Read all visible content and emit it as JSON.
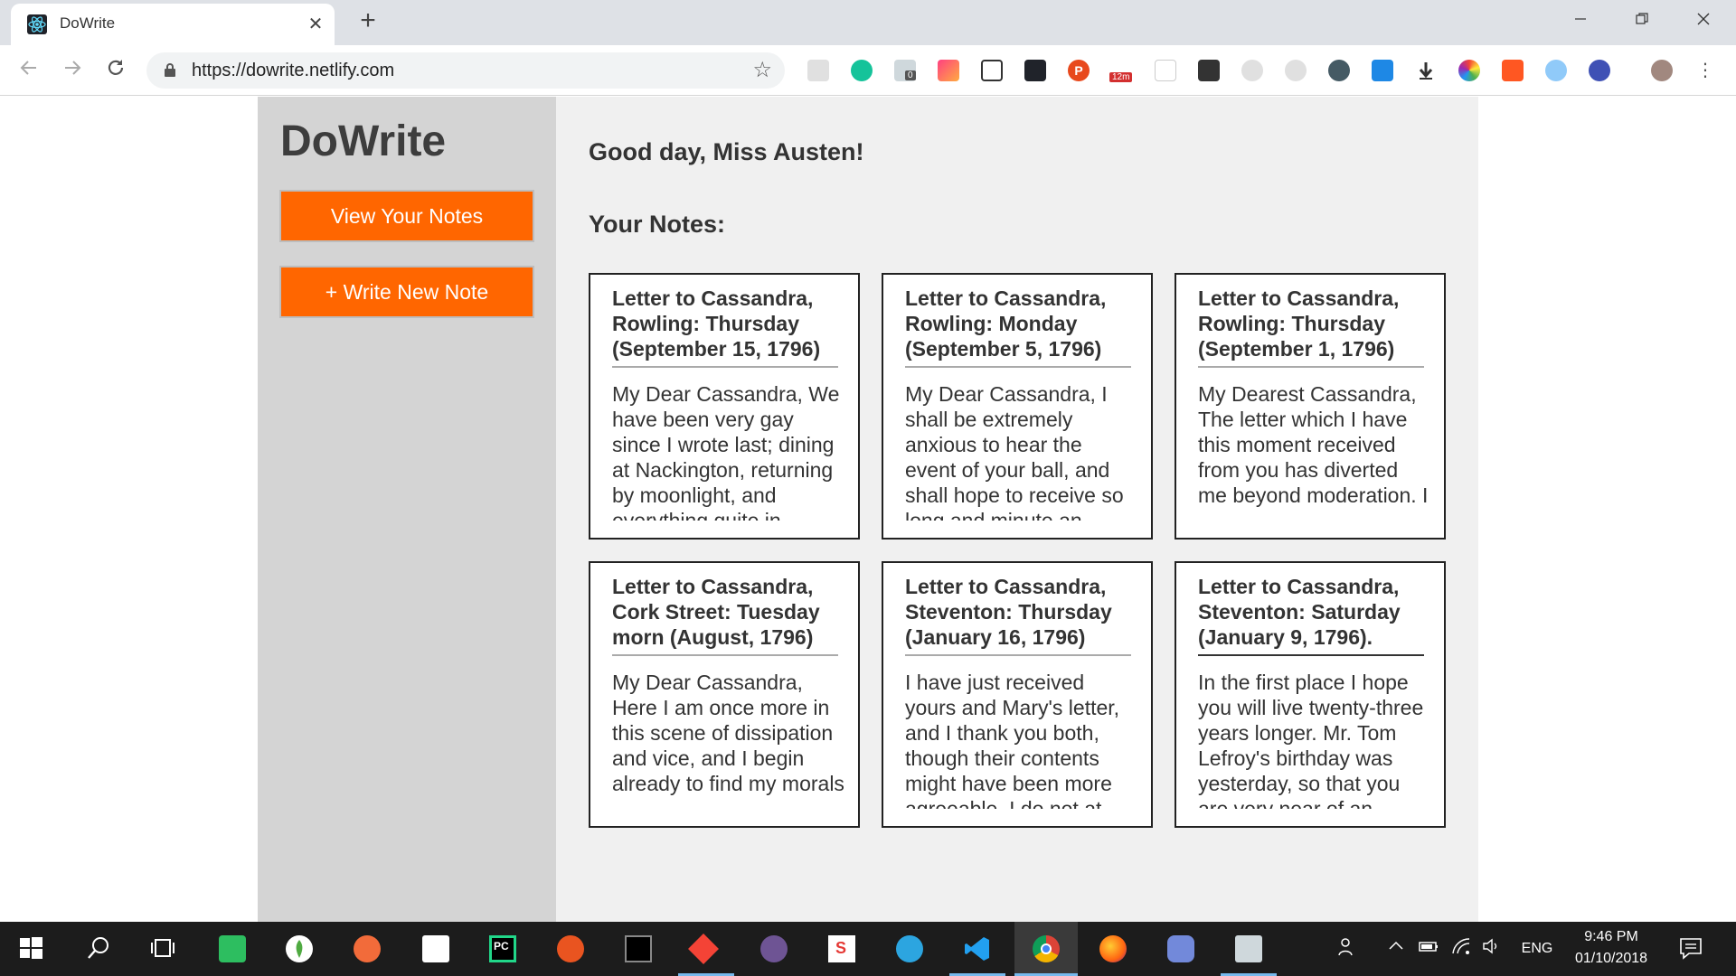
{
  "browser": {
    "tab_title": "DoWrite",
    "tab_close": "✕",
    "new_tab": "+",
    "url": "https://dowrite.netlify.com",
    "extension_badges": {
      "counter": "0",
      "timer": "12m"
    }
  },
  "app": {
    "title": "DoWrite",
    "buttons": {
      "view_notes": "View Your Notes",
      "write_note": "+ Write New Note"
    },
    "greeting": "Good day, Miss Austen!",
    "notes_heading": "Your Notes:",
    "accent_color": "#ff6600"
  },
  "notes": [
    {
      "title": "Letter to Cassandra, Rowling: Thursday (September 15, 1796)",
      "body": "My Dear Cassandra, We have been very gay since I wrote last; dining at Nackington, returning by moonlight, and everything quite in"
    },
    {
      "title": "Letter to Cassandra, Rowling: Monday (September 5, 1796)",
      "body": "My Dear Cassandra, I shall be extremely anxious to hear the event of your ball, and shall hope to receive so long and minute an"
    },
    {
      "title": "Letter to Cassandra, Rowling: Thursday (September 1, 1796)",
      "body": "My Dearest Cassandra, The letter which I have this moment received from you has diverted me beyond moderation. I"
    },
    {
      "title": "Letter to Cassandra, Cork Street: Tuesday morn (August, 1796)",
      "body": "My Dear Cassandra, Here I am once more in this scene of dissipation and vice, and I begin already to find my morals"
    },
    {
      "title": "Letter to Cassandra, Steventon: Thursday (January 16, 1796)",
      "body": "I have just received yours and Mary's letter, and I thank you both, though their contents might have been more agreeable. I do not at"
    },
    {
      "title": "Letter to Cassandra, Steventon: Saturday (January 9, 1796).",
      "body": "In the first place I hope you will live twenty-three years longer. Mr. Tom Lefroy's birthday was yesterday, so that you are very near of an"
    }
  ],
  "taskbar": {
    "language": "ENG",
    "time": "9:46 PM",
    "date": "01/10/2018"
  }
}
